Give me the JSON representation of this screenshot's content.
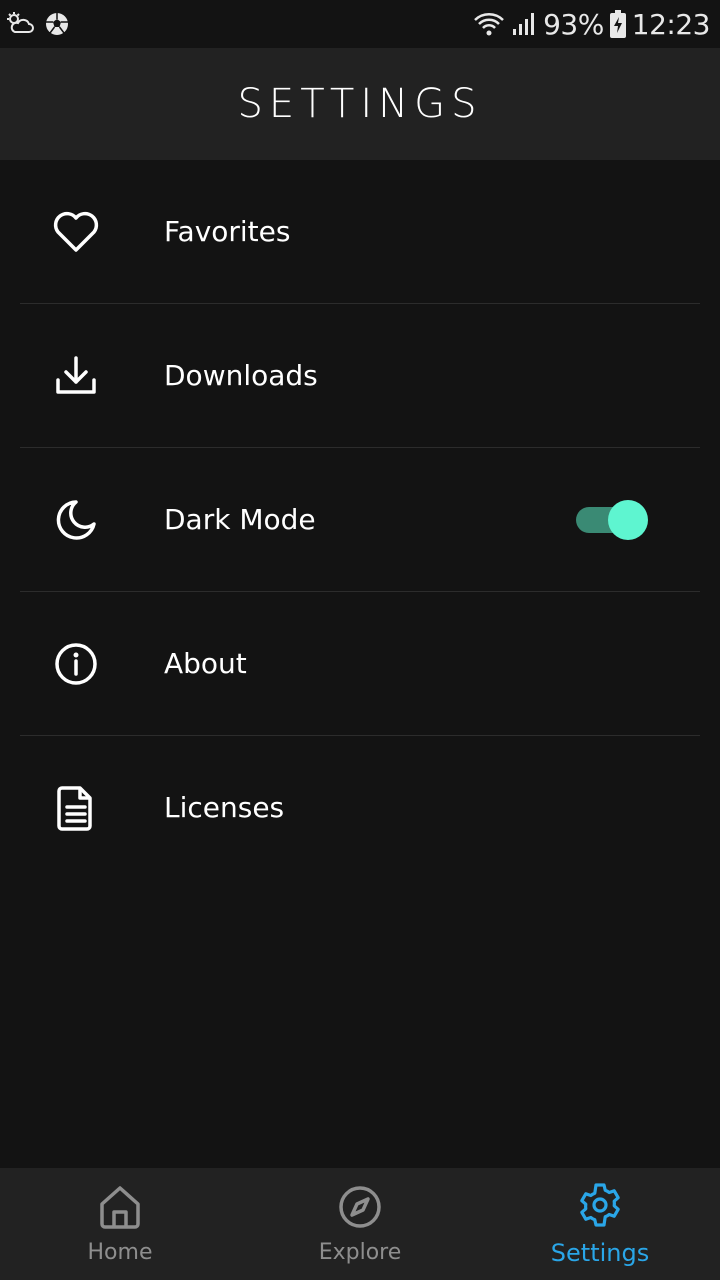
{
  "status_bar": {
    "battery_percent": "93%",
    "time": "12:23",
    "icons": [
      "weather-cloud-icon",
      "soccer-ball-icon",
      "wifi-icon",
      "signal-icon",
      "battery-charging-icon"
    ]
  },
  "header": {
    "title": "SETTINGS"
  },
  "settings": {
    "items": [
      {
        "label": "Favorites",
        "icon": "heart-icon"
      },
      {
        "label": "Downloads",
        "icon": "download-icon"
      },
      {
        "label": "Dark Mode",
        "icon": "moon-icon",
        "toggle_on": true
      },
      {
        "label": "About",
        "icon": "info-icon"
      },
      {
        "label": "Licenses",
        "icon": "document-icon"
      }
    ]
  },
  "bottom_nav": {
    "items": [
      {
        "label": "Home",
        "icon": "home-icon",
        "active": false
      },
      {
        "label": "Explore",
        "icon": "compass-icon",
        "active": false
      },
      {
        "label": "Settings",
        "icon": "gear-icon",
        "active": true
      }
    ]
  },
  "colors": {
    "background": "#131313",
    "header_bg": "#222222",
    "accent": "#2aa6e8",
    "toggle_track": "#3a8a74",
    "toggle_thumb": "#5ef5d0",
    "inactive_nav": "#8e8e8e"
  }
}
